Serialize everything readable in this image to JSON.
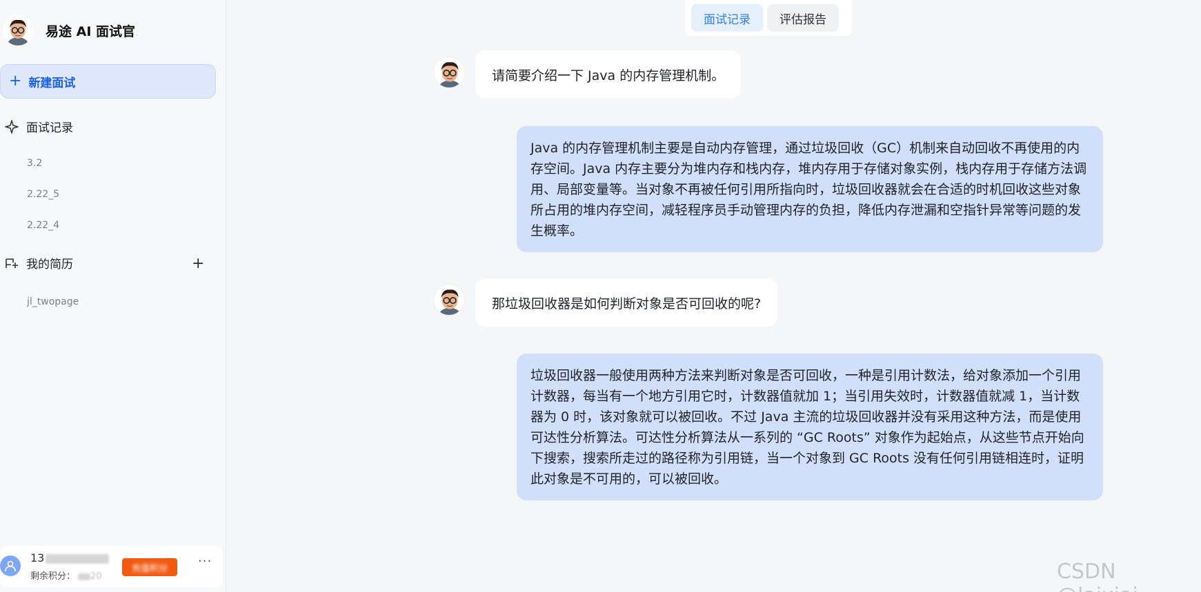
{
  "app": {
    "title": "易途 AI 面试官"
  },
  "sidebar": {
    "new_interview_label": "新建面试",
    "records_label": "面试记录",
    "records": [
      "3.2",
      "2.22_5",
      "2.22_4"
    ],
    "resume_label": "我的简历",
    "resumes": [
      "jl_twopage"
    ],
    "user": {
      "phone_prefix": "13",
      "points_label": "剩余积分：",
      "points_suffix": "20",
      "recharge_label": "充值积分",
      "more_label": "···"
    }
  },
  "tabs": [
    {
      "label": "面试记录",
      "active": true
    },
    {
      "label": "评估报告",
      "active": false
    }
  ],
  "messages": [
    {
      "role": "bot",
      "text": "请简要介绍一下 Java 的内存管理机制。"
    },
    {
      "role": "user",
      "text": "Java 的内存管理机制主要是自动内存管理，通过垃圾回收（GC）机制来自动回收不再使用的内存空间。Java 内存主要分为堆内存和栈内存，堆内存用于存储对象实例，栈内存用于存储方法调用、局部变量等。当对象不再被任何引用所指向时，垃圾回收器就会在合适的时机回收这些对象所占用的堆内存空间，减轻程序员手动管理内存的负担，降低内存泄漏和空指针异常等问题的发生概率。"
    },
    {
      "role": "bot",
      "text": "那垃圾回收器是如何判断对象是否可回收的呢?"
    },
    {
      "role": "user",
      "text": "垃圾回收器一般使用两种方法来判断对象是否可回收，一种是引用计数法，给对象添加一个引用计数器，每当有一个地方引用它时，计数器值就加 1；当引用失效时，计数器值就减 1，当计数器为 0 时，该对象就可以被回收。不过 Java 主流的垃圾回收器并没有采用这种方法，而是使用可达性分析算法。可达性分析算法从一系列的 “GC Roots” 对象作为起始点，从这些节点开始向下搜索，搜索所走过的路径称为引用链，当一个对象到 GC Roots 没有任何引用链相连时，证明此对象是不可用的，可以被回收。"
    }
  ],
  "watermark": "CSDN @laixiai",
  "colors": {
    "accent": "#1a62e8",
    "user_bubble": "#d1dffb",
    "recharge": "#f25a12"
  }
}
